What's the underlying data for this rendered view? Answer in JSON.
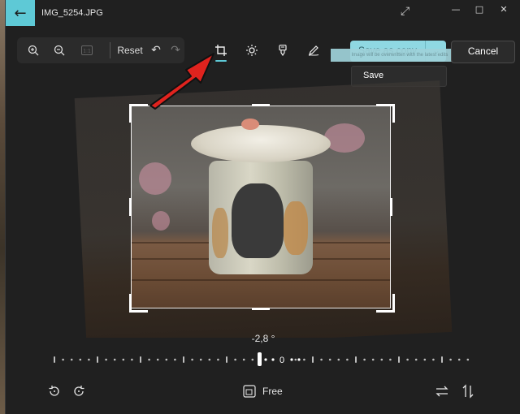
{
  "window": {
    "title": "IMG_5254.JPG"
  },
  "toolbar": {
    "reset_label": "Reset",
    "zoom_in_icon": "zoom-in-icon",
    "zoom_out_icon": "zoom-out-icon",
    "actual_size_icon": "actual-size-icon",
    "undo_icon": "undo-icon",
    "redo_icon": "redo-icon"
  },
  "edit_tools": [
    "crop-icon",
    "adjust-icon",
    "filter-icon",
    "markup-icon"
  ],
  "save": {
    "save_as_copy_label": "Save as copy",
    "tooltip": "Image will be overwritten with the latest edits",
    "dropdown_item": "Save",
    "cancel_label": "Cancel"
  },
  "straighten": {
    "angle_text": "-2,8 °",
    "zero_label": "0",
    "angle_degrees": -2.8
  },
  "bottom_bar": {
    "aspect_label": "Free"
  },
  "colors": {
    "accent": "#5ec9d6",
    "arrow": "#e0231e",
    "background": "#202020"
  }
}
